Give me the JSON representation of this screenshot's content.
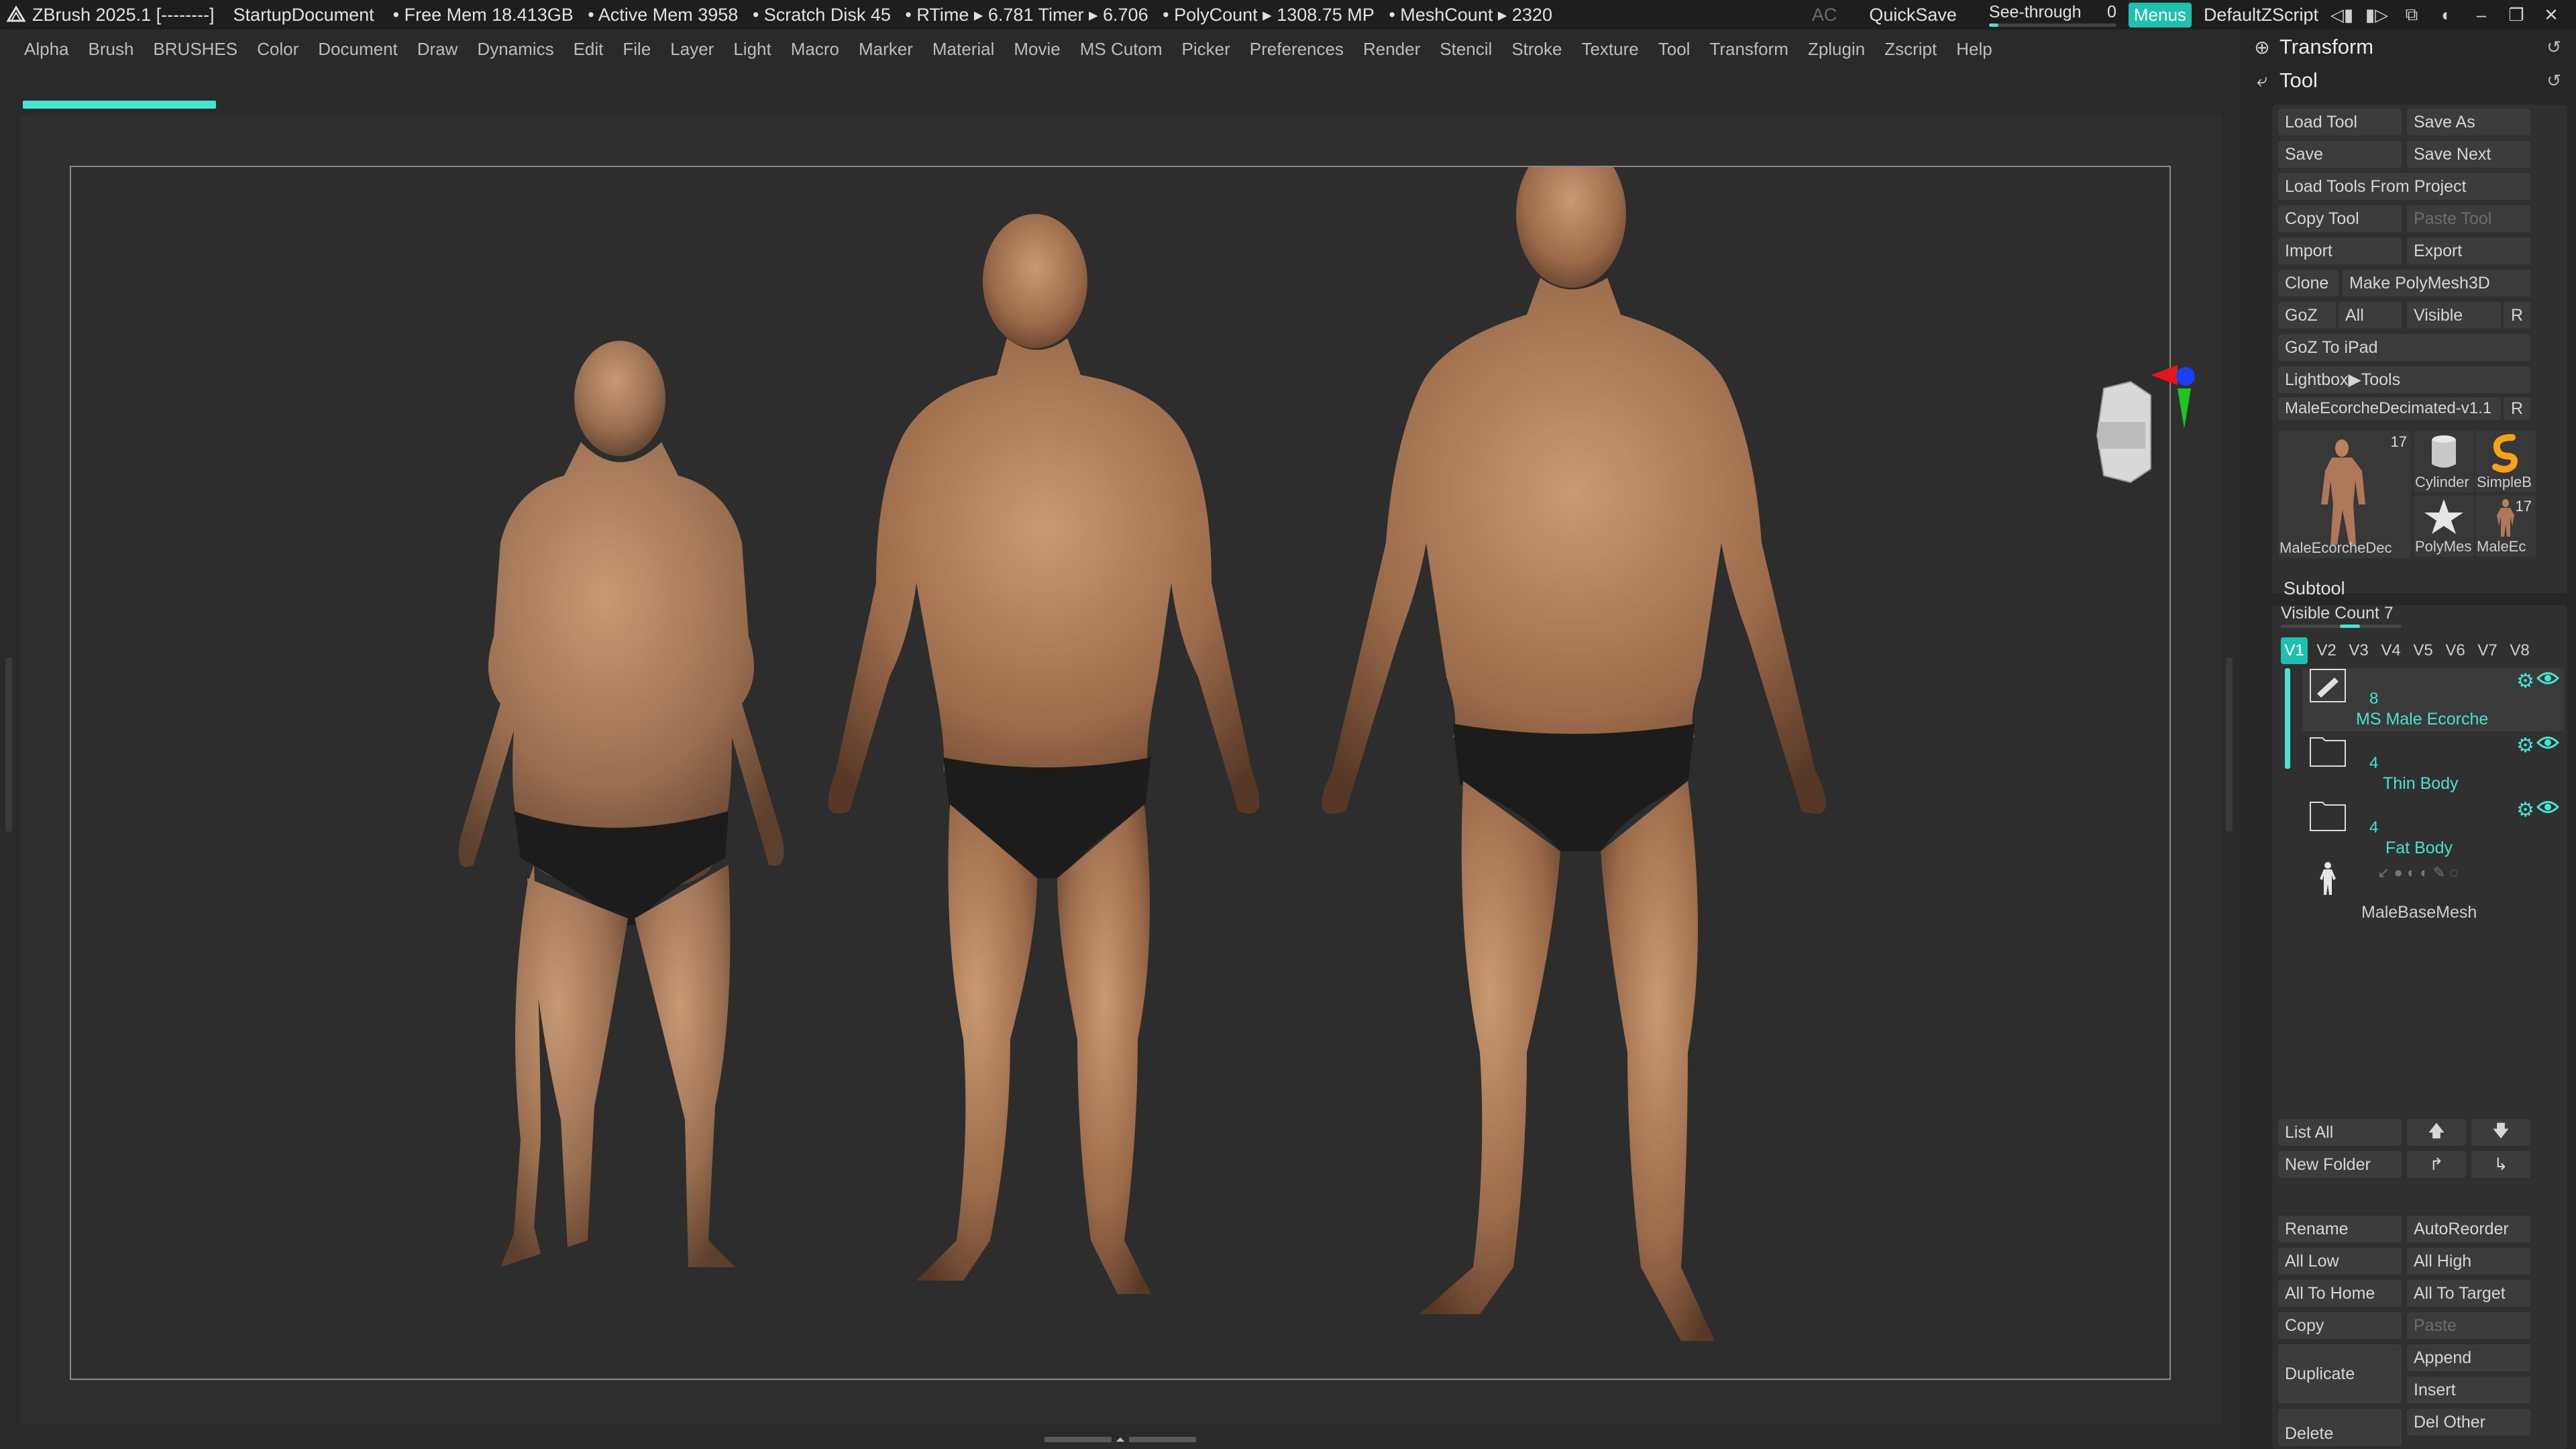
{
  "titlebar": {
    "app": "ZBrush 2025.1 [--------]",
    "document": "StartupDocument",
    "status": [
      "• Free Mem 18.413GB",
      "• Active Mem 3958",
      "• Scratch Disk 45",
      "• RTime ▸ 6.781 Timer ▸ 6.706",
      "• PolyCount ▸ 1308.75 MP",
      "• MeshCount ▸ 2320"
    ],
    "ac": "AC",
    "quicksave": "QuickSave",
    "seethrough_label": "See-through",
    "seethrough_value": "0",
    "seethrough_level": 0,
    "menus": "Menus",
    "script": "DefaultZScript"
  },
  "menubar": [
    "Alpha",
    "Brush",
    "BRUSHES",
    "Color",
    "Document",
    "Draw",
    "Dynamics",
    "Edit",
    "File",
    "Layer",
    "Light",
    "Macro",
    "Marker",
    "Material",
    "Movie",
    "MS Cutom",
    "Picker",
    "Preferences",
    "Render",
    "Stencil",
    "Stroke",
    "Texture",
    "Tool",
    "Transform",
    "Zplugin",
    "Zscript",
    "Help"
  ],
  "tray": {
    "transform_title": "Transform",
    "tool_title": "Tool",
    "buttons": {
      "load_tool": "Load Tool",
      "save_as": "Save As",
      "save": "Save",
      "save_next": "Save Next",
      "load_tools_from_project": "Load Tools From Project",
      "copy_tool": "Copy Tool",
      "paste_tool": "Paste Tool",
      "import": "Import",
      "export": "Export",
      "clone": "Clone",
      "make_polymesh": "Make PolyMesh3D",
      "goz": "GoZ",
      "all": "All",
      "visible": "Visible",
      "r": "R",
      "goz_ipad": "GoZ To iPad",
      "lightbox_tools": "Lightbox▶Tools"
    },
    "current_tool": "MaleEcorcheDecimated-v1.1",
    "current_tool_r": "R",
    "thumbs": {
      "main_label": "MaleEcorcheDec",
      "main_count": "17",
      "cylinder": "Cylinder",
      "simpleb": "SimpleB",
      "polymesh": "PolyMes",
      "maleec": "MaleEc",
      "maleec_count": "17"
    },
    "subtool": {
      "title": "Subtool",
      "visible_count": "Visible Count 7",
      "tabs": [
        "V1",
        "V2",
        "V3",
        "V4",
        "V5",
        "V6",
        "V7",
        "V8"
      ],
      "items": [
        {
          "count": "8",
          "name": "MS Male Ecorche"
        },
        {
          "count": "4",
          "name": "Thin Body"
        },
        {
          "count": "4",
          "name": "Fat Body"
        },
        {
          "count": "",
          "name": "MaleBaseMesh"
        }
      ],
      "list_all": "List All",
      "new_folder": "New Folder",
      "rename": "Rename",
      "autoreorder": "AutoReorder",
      "all_low": "All Low",
      "all_high": "All High",
      "all_to_home": "All To Home",
      "all_to_target": "All To Target",
      "copy": "Copy",
      "paste": "Paste",
      "duplicate": "Duplicate",
      "append": "Append",
      "insert": "Insert",
      "del_other": "Del Other",
      "delete": "Delete"
    }
  },
  "colors": {
    "accent": "#48e3d1",
    "menus_bg": "#1fbfb2",
    "skin": "#a77a5a",
    "underwear": "#1c1c1c"
  },
  "icons": {
    "app_logo": "zbrush-logo-icon",
    "transform": "transform-icon",
    "tool": "tool-icon",
    "reset": "reset-icon",
    "gear": "gear-icon",
    "eye": "eye-icon",
    "folder": "folder-icon",
    "brush": "brush-icon",
    "arrow_up": "arrow-up-icon",
    "arrow_down": "arrow-down-icon"
  }
}
